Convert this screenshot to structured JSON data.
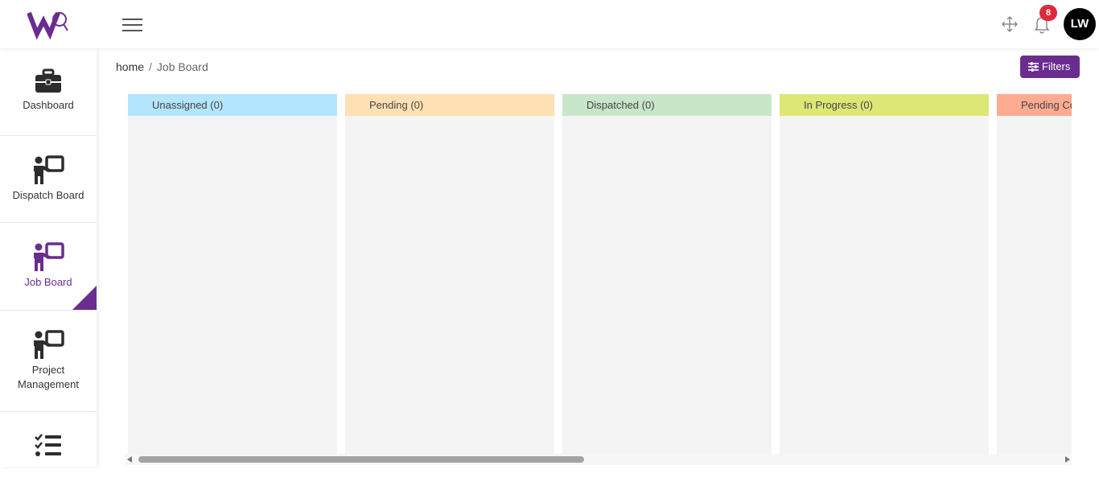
{
  "header": {
    "menu_icon": "hamburger-menu-icon",
    "notifications_count": "8",
    "avatar_initials": "LW",
    "brand_color": "#6a2d8f"
  },
  "sidebar": {
    "items": [
      {
        "label": "Dashboard",
        "icon": "briefcase-icon",
        "active": false
      },
      {
        "label": "Dispatch Board",
        "icon": "presenter-board-icon",
        "active": false
      },
      {
        "label": "Job Board",
        "icon": "presenter-board-icon",
        "active": true
      },
      {
        "label": "Project Management",
        "icon": "presenter-board-icon",
        "active": false
      },
      {
        "label": "",
        "icon": "checklist-icon",
        "active": false
      }
    ]
  },
  "breadcrumb": {
    "home": "home",
    "separator": "/",
    "current": "Job Board"
  },
  "filters_button": {
    "label": "Filters",
    "icon": "sliders-icon"
  },
  "board": {
    "columns": [
      {
        "title": "Unassigned (0)",
        "color": "#b3e5fc"
      },
      {
        "title": "Pending (0)",
        "color": "#ffe0b2"
      },
      {
        "title": "Dispatched (0)",
        "color": "#c8e6c9"
      },
      {
        "title": "In Progress (0)",
        "color": "#dce775"
      },
      {
        "title": "Pending Co",
        "color": "#ffab91"
      }
    ]
  }
}
